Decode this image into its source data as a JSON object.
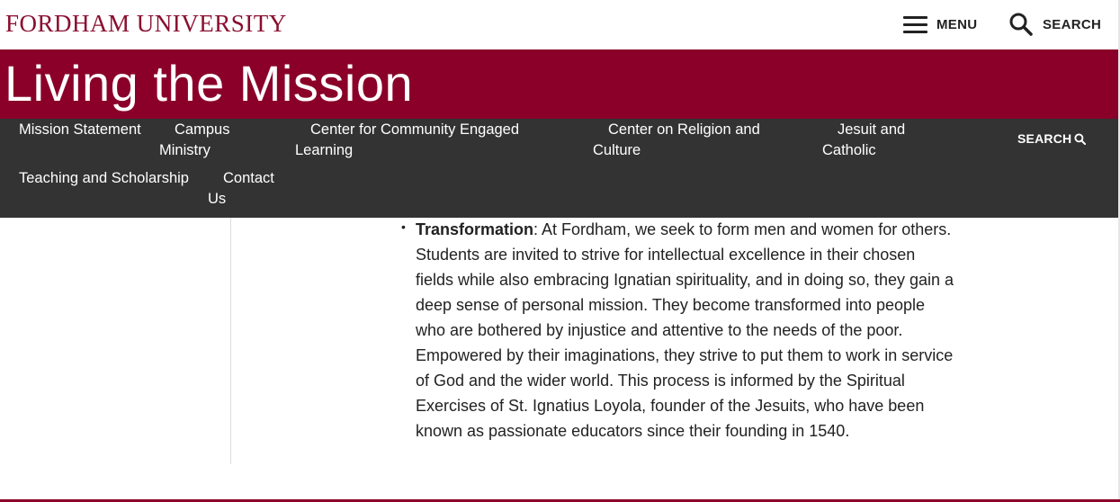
{
  "header": {
    "logo": "FORDHAM UNIVERSITY",
    "menu_label": "MENU",
    "search_label": "SEARCH"
  },
  "banner": {
    "title": "Living the Mission",
    "bg_color": "#8a0029"
  },
  "nav": {
    "items": [
      {
        "line1": "Mission Statement",
        "line2": ""
      },
      {
        "line1": "Campus",
        "line2": "Ministry"
      },
      {
        "line1": "Center for Community Engaged",
        "line2": "Learning"
      },
      {
        "line1": "Center on Religion and",
        "line2": "Culture"
      },
      {
        "line1": "Jesuit and",
        "line2": "Catholic"
      },
      {
        "line1": "Teaching and Scholarship",
        "line2": ""
      },
      {
        "line1": "Contact",
        "line2": "Us"
      }
    ],
    "search_label": "SEARCH"
  },
  "content": {
    "bullet_term": "Transformation",
    "bullet_text": ": At Fordham, we seek to form men and women for others. Students are invited to strive for intellectual excellence in their chosen fields while also embracing Ignatian spirituality, and in doing so, they gain a deep sense of personal mission. They become transformed into people who are bothered by injustice and attentive to the needs of the poor. Empowered by their imaginations, they strive to put them to work in service of God and the wider world. This process is informed by the Spiritual Exercises of St. Ignatius Loyola, founder of the Jesuits, who have been known as passionate educators since their founding in 1540."
  },
  "colors": {
    "brand_maroon": "#8a0029",
    "nav_bg": "#333333"
  },
  "icons": [
    "menu-icon",
    "search-icon"
  ]
}
